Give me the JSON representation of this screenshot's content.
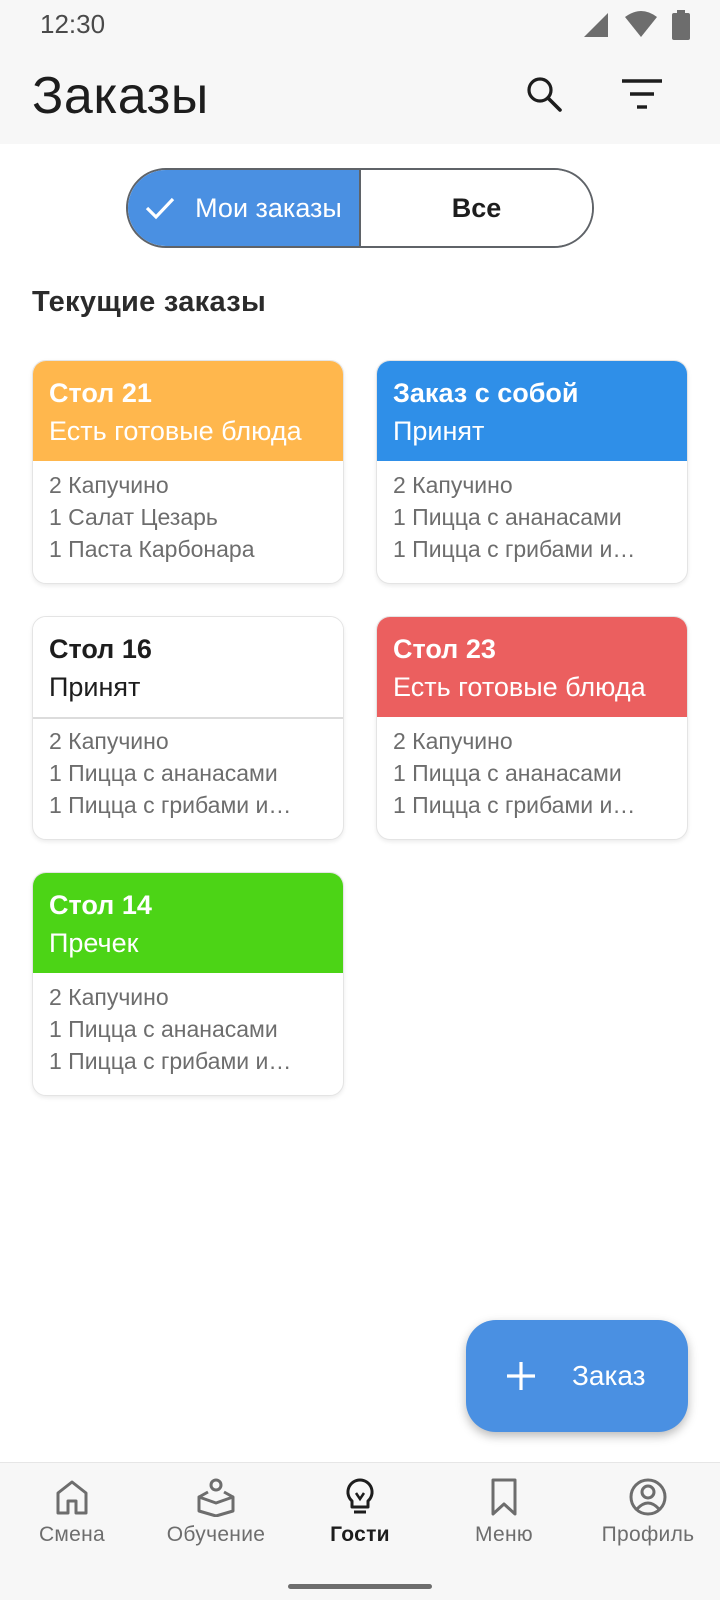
{
  "status_bar": {
    "time": "12:30"
  },
  "header": {
    "title": "Заказы"
  },
  "filter_toggle": {
    "mine_label": "Мои заказы",
    "all_label": "Все",
    "selected": "mine"
  },
  "section": {
    "heading": "Текущие заказы"
  },
  "orders": [
    {
      "title": "Стол 21",
      "status": "Есть готовые блюда",
      "color": "#ffb74d",
      "text_color": "#ffffff",
      "items": [
        "2 Капучино",
        "1 Салат Цезарь",
        "1 Паста Карбонара"
      ]
    },
    {
      "title": "Заказ с собой",
      "status": "Принят",
      "color": "#2f8fe8",
      "text_color": "#ffffff",
      "items": [
        "2 Капучино",
        "1 Пицца с ананасами",
        "1 Пицца с грибами и…"
      ]
    },
    {
      "title": "Стол 16",
      "status": "Принят",
      "color": "#ffffff",
      "text_color": "#1d1d1d",
      "items": [
        "2 Капучино",
        "1 Пицца с ананасами",
        "1 Пицца с грибами и…"
      ]
    },
    {
      "title": "Стол 23",
      "status": "Есть готовые блюда",
      "color": "#eb5f5f",
      "text_color": "#ffffff",
      "items": [
        "2 Капучино",
        "1 Пицца с ананасами",
        "1 Пицца с грибами и…"
      ]
    },
    {
      "title": "Стол 14",
      "status": "Пречек",
      "color": "#4cd416",
      "text_color": "#ffffff",
      "items": [
        "2 Капучино",
        "1 Пицца с ананасами",
        "1 Пицца с грибами и…"
      ]
    }
  ],
  "fab": {
    "label": "Заказ",
    "icon": "plus-icon"
  },
  "bottom_nav": {
    "items": [
      {
        "label": "Смена",
        "icon": "home-icon"
      },
      {
        "label": "Обучение",
        "icon": "book-reader-icon"
      },
      {
        "label": "Гости",
        "icon": "lightbulb-icon"
      },
      {
        "label": "Меню",
        "icon": "bookmark-icon"
      },
      {
        "label": "Профиль",
        "icon": "profile-icon"
      }
    ],
    "active": "Гости"
  },
  "colors": {
    "accent": "#4a90e2",
    "background": "#ffffff",
    "bar_background": "#f7f7f7"
  }
}
